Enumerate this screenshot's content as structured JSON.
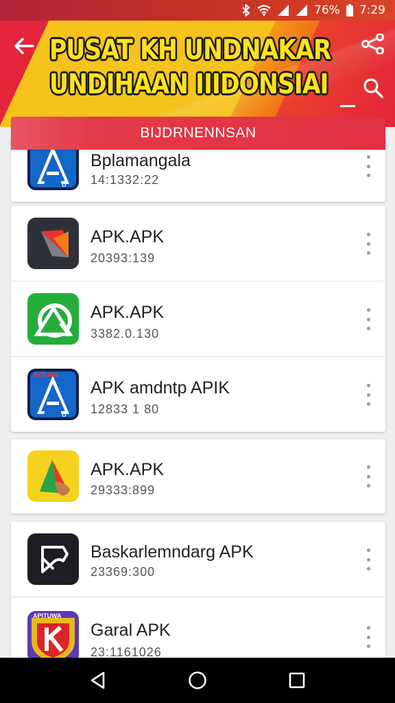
{
  "status_bar": {
    "battery_text": "76%",
    "time": "7:29"
  },
  "header": {
    "title_line1": "PUSAT KH UNDNAKAR",
    "title_line2": "UNDIHAAN IIIDONSIAI"
  },
  "tab": {
    "label": "BIJDRNENNSAN"
  },
  "apps": [
    {
      "name": "Bplamangala",
      "meta": "14:1332:22",
      "icon": "blue-a-icon"
    },
    {
      "name": "APK.APK",
      "meta": "20393:139",
      "icon": "dark-red-triangle-icon"
    },
    {
      "name": "APK.APK",
      "meta": "3382.0.130",
      "icon": "green-arrow-icon"
    },
    {
      "name": "APK  amdntp APIK",
      "meta": "12833 1 80",
      "icon": "blue-a-icon"
    },
    {
      "name": "APK.APK",
      "meta": "29333:899",
      "icon": "yellow-triangle-icon"
    },
    {
      "name": "Baskarlemndarg APK",
      "meta": "23369:300",
      "icon": "dark-flag-icon"
    },
    {
      "name": "Garal APK",
      "meta": "23:1161026",
      "icon": "shield-k-icon"
    }
  ],
  "colors": {
    "accent_red": "#e3243a",
    "accent_yellow": "#f6c21c",
    "nav_bg": "#000000"
  }
}
